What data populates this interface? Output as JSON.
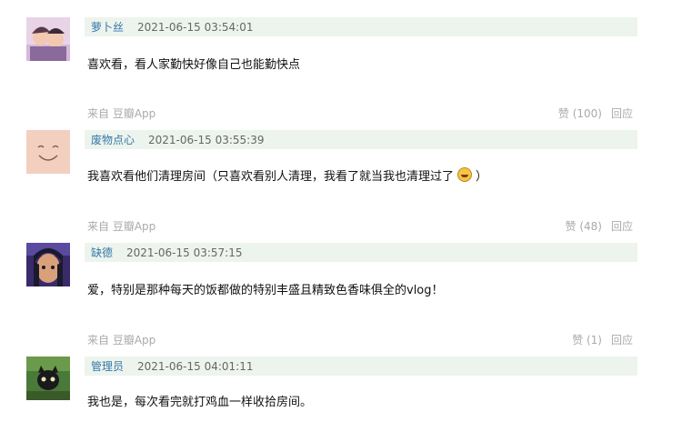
{
  "comments": [
    {
      "author": "萝卜丝",
      "time": "2021-06-15 03:54:01",
      "content": "喜欢看，看人家勤快好像自己也能勤快点",
      "from": "来自 豆瓣App",
      "vote": "赞 (100)",
      "reply": "回应",
      "avatar_colors": [
        "#e8d4e6",
        "#8a6a9a",
        "#f2c9b0"
      ]
    },
    {
      "author": "废物点心",
      "time": "2021-06-15 03:55:39",
      "content": "我喜欢看他们清理房间（只喜欢看别人清理，我看了就当我也清理过了",
      "content_end": "）",
      "emoji": "grin-sweat-icon",
      "from": "来自 豆瓣App",
      "vote": "赞 (48)",
      "reply": "回应",
      "avatar_colors": [
        "#f3cfc0",
        "#8a5a4a"
      ]
    },
    {
      "author": "缺德",
      "time": "2021-06-15 03:57:15",
      "content": "爱，特别是那种每天的饭都做的特别丰盛且精致色香味俱全的vlog！",
      "from": "来自 豆瓣App",
      "vote": "赞 (1)",
      "reply": "回应",
      "avatar_colors": [
        "#3a2a6a",
        "#d9a07a",
        "#1a1a2a"
      ]
    },
    {
      "author": "管理员",
      "time": "2021-06-15 04:01:11",
      "content": "我也是，每次看完就打鸡血一样收拾房间。",
      "avatar_colors": [
        "#4a7a3a",
        "#1a1a1a",
        "#e8e8c0"
      ]
    }
  ]
}
